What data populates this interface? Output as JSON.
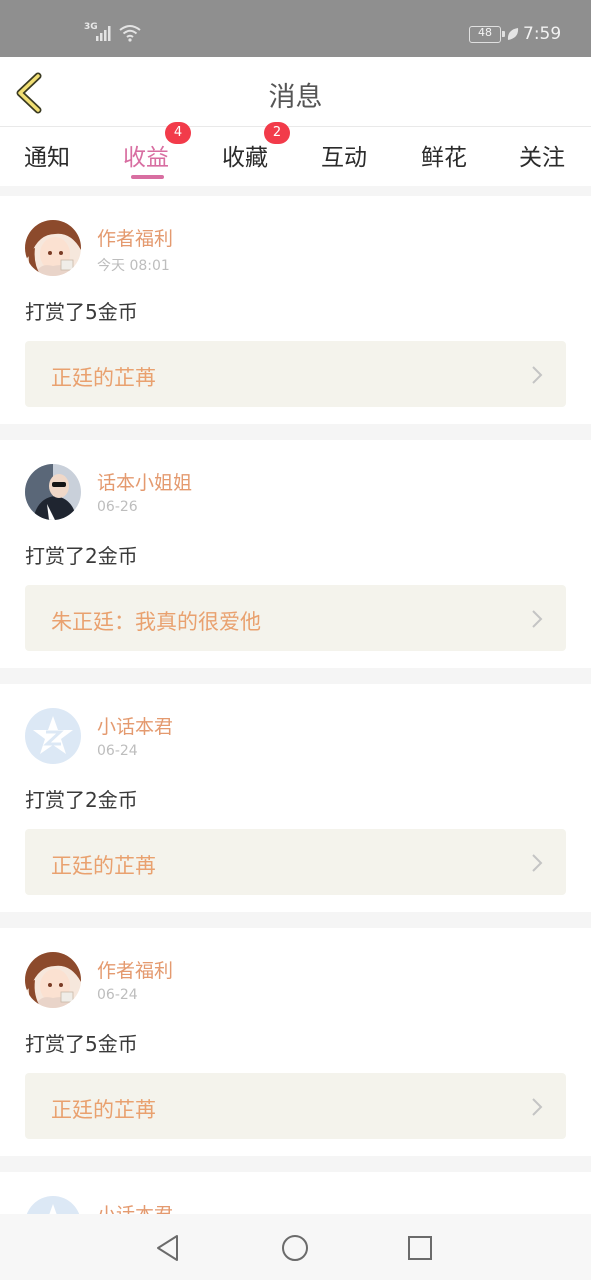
{
  "status_bar": {
    "network": "3G",
    "battery": "48",
    "time": "7:59"
  },
  "header": {
    "title": "消息",
    "back_icon": "chevron-left-icon"
  },
  "tabs": [
    {
      "label": "通知",
      "active": false,
      "badge": ""
    },
    {
      "label": "收益",
      "active": true,
      "badge": "4"
    },
    {
      "label": "收藏",
      "active": false,
      "badge": "2"
    },
    {
      "label": "互动",
      "active": false,
      "badge": ""
    },
    {
      "label": "鲜花",
      "active": false,
      "badge": ""
    },
    {
      "label": "关注",
      "active": false,
      "badge": ""
    }
  ],
  "messages": [
    {
      "user": "作者福利",
      "time": "今天 08:01",
      "desc": "打赏了5金币",
      "work": "正廷的芷苒",
      "avatar": "anime-girl-avatar"
    },
    {
      "user": "话本小姐姐",
      "time": "06-26",
      "desc": "打赏了2金币",
      "work": "朱正廷：我真的很爱他",
      "avatar": "photo-avatar"
    },
    {
      "user": "小话本君",
      "time": "06-24",
      "desc": "打赏了2金币",
      "work": "正廷的芷苒",
      "avatar": "app-logo-avatar"
    },
    {
      "user": "作者福利",
      "time": "06-24",
      "desc": "打赏了5金币",
      "work": "正廷的芷苒",
      "avatar": "anime-girl-avatar"
    },
    {
      "user": "小话本君"
    }
  ],
  "colors": {
    "accent": "#d86ea1",
    "name": "#e49a6f",
    "badge": "#f23b4a",
    "status_bar": "#8f8f8f"
  },
  "nav_bar": {
    "back": "triangle-back-icon",
    "home": "circle-home-icon",
    "recents": "square-recents-icon"
  }
}
